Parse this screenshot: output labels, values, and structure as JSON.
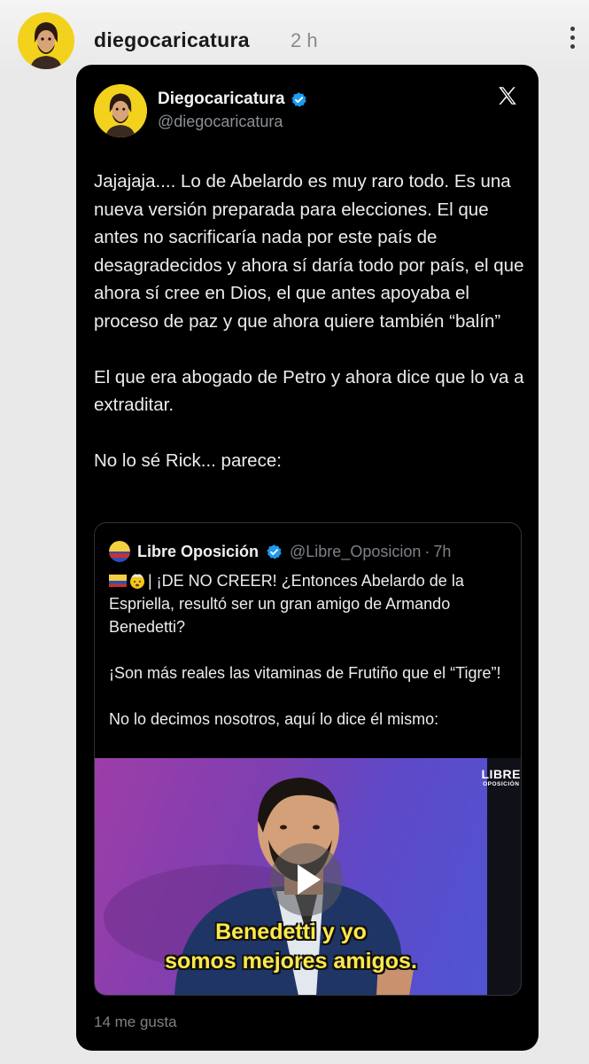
{
  "story": {
    "username": "diegocaricatura",
    "time": "2 h"
  },
  "tweet": {
    "display_name": "Diegocaricatura",
    "handle": "@diegocaricatura",
    "paragraphs": [
      "Jajajaja.... Lo de Abelardo es muy raro todo. Es una nueva versión preparada para elecciones. El que antes no sacrificaría nada por este país de desagradecidos y ahora sí daría todo por país, el que ahora sí cree en Dios, el que antes apoyaba el proceso de paz y que ahora quiere también “balín”",
      "El que era abogado de Petro y ahora dice que lo va a extraditar.",
      "No lo sé Rick... parece:"
    ],
    "likes": "14 me gusta"
  },
  "quote": {
    "display_name": "Libre Oposición",
    "handle": "@Libre_Oposicion",
    "separator": "·",
    "time": "7h",
    "paragraphs": [
      "| ¡DE NO CREER! ¿Entonces Abelardo de la Espriella, resultó ser un gran amigo de Armando Benedetti?",
      "¡Son más reales las vitaminas de Frutiño que el “Tigre”!",
      "No lo decimos nosotros, aquí lo dice él mismo:"
    ],
    "video": {
      "watermark_top": "LIBRE",
      "watermark_bottom": "OPOSICIÓN",
      "subtitle_line1": "Benedetti y yo",
      "subtitle_line2": "somos mejores amigos."
    }
  },
  "colors": {
    "verified": "#1d9bf0",
    "avatar_bg": "#f2d21c",
    "subtitle": "#ffe94a"
  }
}
